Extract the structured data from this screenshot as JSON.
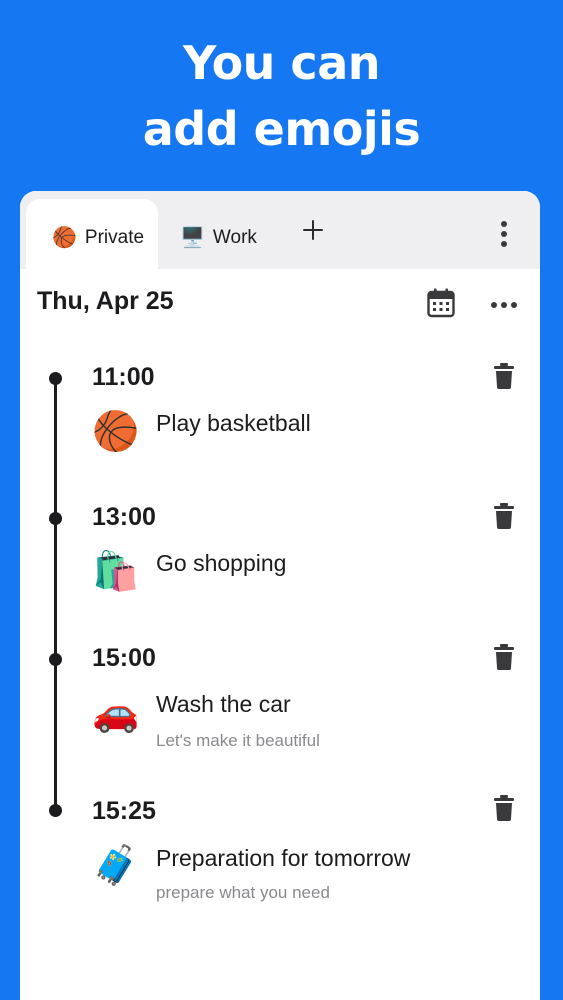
{
  "promo": {
    "line1": "You can",
    "line2": "add emojis"
  },
  "tabs": [
    {
      "emoji": "🏀",
      "label": "Private",
      "active": true
    },
    {
      "emoji": "🖥️",
      "label": "Work",
      "active": false
    }
  ],
  "icons": {
    "add_tab": "plus-icon",
    "tab_menu": "more-vertical-icon",
    "calendar": "calendar-icon",
    "day_menu": "more-horizontal-icon",
    "delete": "trash-icon"
  },
  "date_header": "Thu, Apr 25",
  "schedule": [
    {
      "time": "11:00",
      "emoji": "🏀",
      "title": "Play basketball",
      "note": ""
    },
    {
      "time": "13:00",
      "emoji": "🛍️",
      "title": "Go shopping",
      "note": ""
    },
    {
      "time": "15:00",
      "emoji": "🚗",
      "title": "Wash the car",
      "note": "Let's make it beautiful"
    },
    {
      "time": "15:25",
      "emoji": "🧳",
      "title": "Preparation for tomorrow",
      "note": "prepare what you need"
    }
  ],
  "colors": {
    "background": "#1577F2",
    "card": "#ffffff",
    "tabbar": "#EFEFF1",
    "text": "#1c1c1e",
    "muted": "#8a8a8e"
  }
}
